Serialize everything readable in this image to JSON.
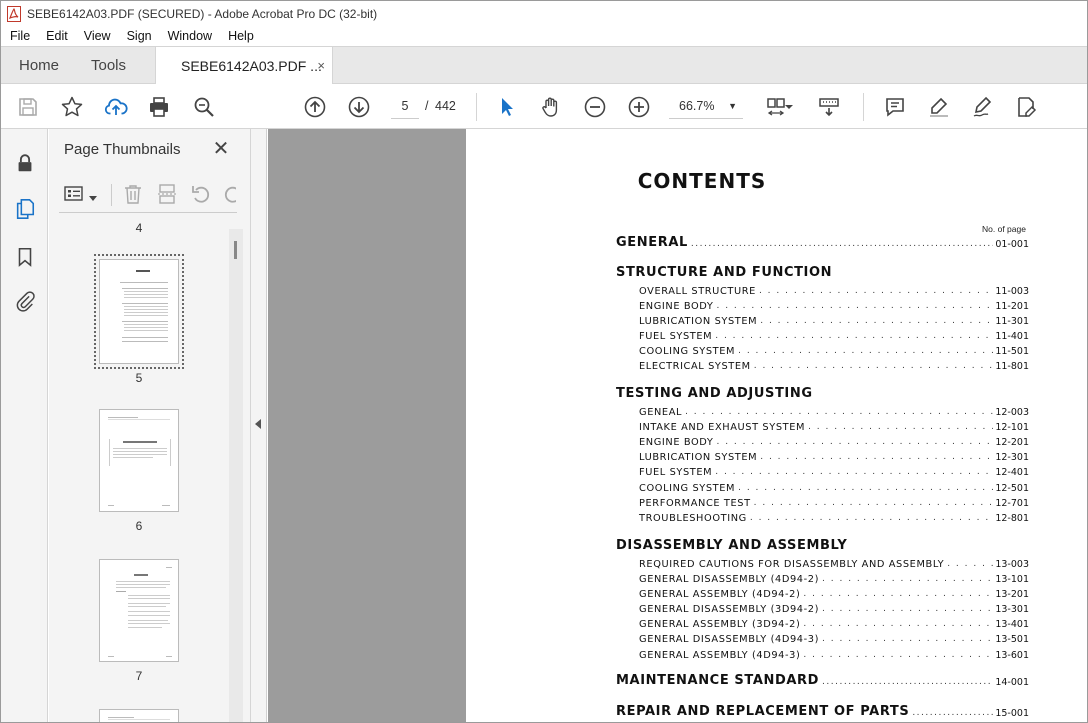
{
  "window": {
    "title": "SEBE6142A03.PDF (SECURED) - Adobe Acrobat Pro DC (32-bit)"
  },
  "menu": [
    "File",
    "Edit",
    "View",
    "Sign",
    "Window",
    "Help"
  ],
  "tabs": {
    "home": "Home",
    "tools": "Tools",
    "document": "SEBE6142A03.PDF ...",
    "close": "×"
  },
  "toolbar": {
    "current_page": "5",
    "page_separator": "/",
    "page_count": "442",
    "zoom": "66.7%",
    "accent_color": "#1a73c8"
  },
  "thumbnails": {
    "title": "Page Thumbnails",
    "close": "✕",
    "pages": [
      "4",
      "5",
      "6",
      "7"
    ]
  },
  "document": {
    "title": "CONTENTS",
    "page_no_header": "No. of page",
    "sections": [
      {
        "heading": "GENERAL",
        "page": "01-001",
        "items": []
      },
      {
        "heading": "STRUCTURE AND FUNCTION",
        "page": "",
        "items": [
          {
            "label": "OVERALL STRUCTURE",
            "page": "11-003"
          },
          {
            "label": "ENGINE BODY",
            "page": "11-201"
          },
          {
            "label": "LUBRICATION SYSTEM",
            "page": "11-301"
          },
          {
            "label": "FUEL SYSTEM",
            "page": "11-401"
          },
          {
            "label": "COOLING SYSTEM",
            "page": "11-501"
          },
          {
            "label": "ELECTRICAL SYSTEM",
            "page": "11-801"
          }
        ]
      },
      {
        "heading": "TESTING AND ADJUSTING",
        "page": "",
        "items": [
          {
            "label": "GENEAL",
            "page": "12-003"
          },
          {
            "label": "INTAKE AND EXHAUST SYSTEM",
            "page": "12-101"
          },
          {
            "label": "ENGINE BODY",
            "page": "12-201"
          },
          {
            "label": "LUBRICATION SYSTEM",
            "page": "12-301"
          },
          {
            "label": "FUEL SYSTEM",
            "page": "12-401"
          },
          {
            "label": "COOLING SYSTEM",
            "page": "12-501"
          },
          {
            "label": "PERFORMANCE TEST",
            "page": "12-701"
          },
          {
            "label": "TROUBLESHOOTING",
            "page": "12-801"
          }
        ]
      },
      {
        "heading": "DISASSEMBLY AND ASSEMBLY",
        "page": "",
        "items": [
          {
            "label": "REQUIRED CAUTIONS FOR DISASSEMBLY AND ASSEMBLY",
            "page": "13-003"
          },
          {
            "label": "GENERAL DISASSEMBLY (4D94-2)",
            "page": "13-101"
          },
          {
            "label": "GENERAL ASSEMBLY (4D94-2)",
            "page": "13-201"
          },
          {
            "label": "GENERAL DISASSEMBLY (3D94-2)",
            "page": "13-301"
          },
          {
            "label": "GENERAL ASSEMBLY (3D94-2)",
            "page": "13-401"
          },
          {
            "label": "GENERAL DISASSEMBLY (4D94-3)",
            "page": "13-501"
          },
          {
            "label": "GENERAL ASSEMBLY (4D94-3)",
            "page": "13-601"
          }
        ]
      },
      {
        "heading": "MAINTENANCE STANDARD",
        "page": "14-001",
        "items": []
      },
      {
        "heading": "REPAIR AND REPLACEMENT OF PARTS",
        "page": "15-001",
        "items": []
      }
    ]
  }
}
